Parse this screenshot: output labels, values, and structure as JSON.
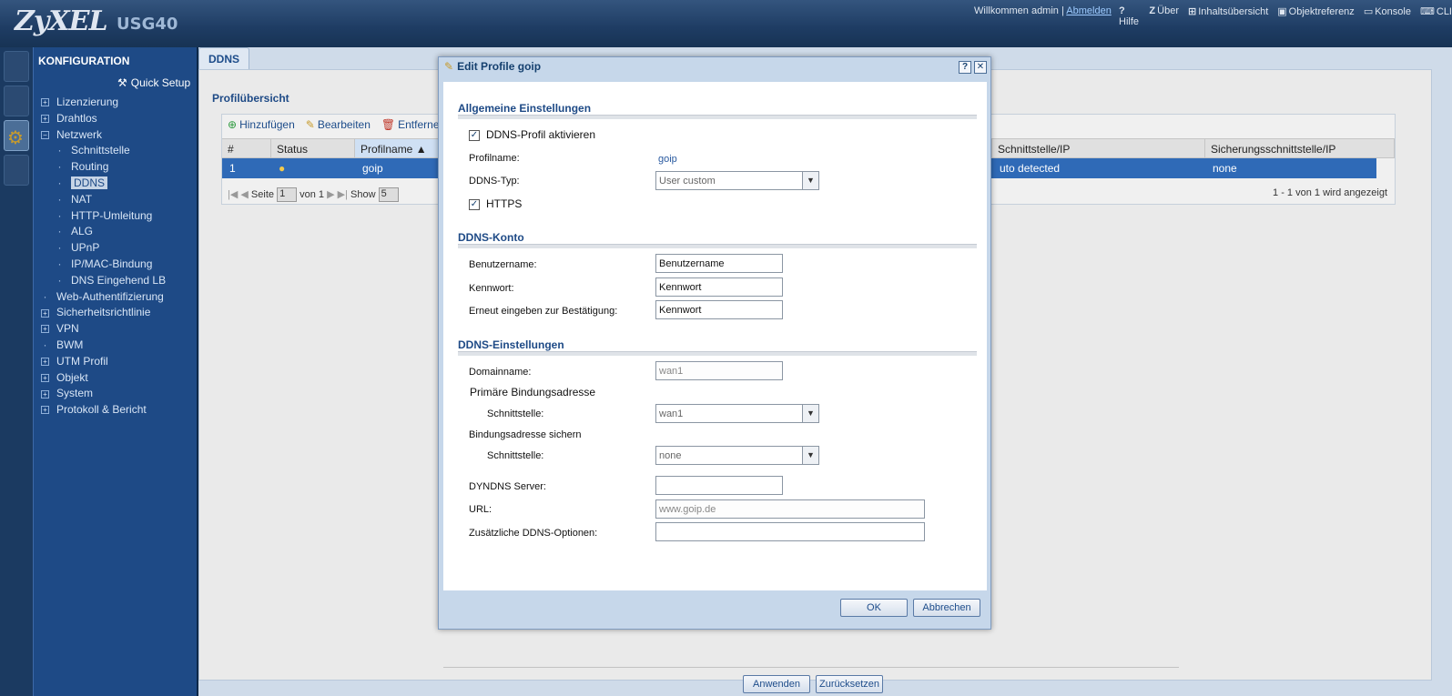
{
  "header": {
    "brand": "ZyXEL",
    "model": "USG40",
    "welcome_prefix": "Willkommen admin |",
    "logout": "Abmelden",
    "links": [
      {
        "icon": "help-icon",
        "glyph": "?",
        "label": "Hilfe"
      },
      {
        "icon": "about-icon",
        "glyph": "Z",
        "label": "Über"
      },
      {
        "icon": "sitemap-icon",
        "glyph": "⊞",
        "label": "Inhaltsübersicht"
      },
      {
        "icon": "object-reference-icon",
        "glyph": "▣",
        "label": "Objektreferenz"
      },
      {
        "icon": "console-icon",
        "glyph": "▭",
        "label": "Konsole"
      },
      {
        "icon": "cli-icon",
        "glyph": "⌨",
        "label": "CLI"
      }
    ]
  },
  "sidebar": {
    "title": "KONFIGURATION",
    "quick_setup": "Quick Setup",
    "items": [
      {
        "label": "Lizenzierung",
        "type": "plus"
      },
      {
        "label": "Drahtlos",
        "type": "plus"
      },
      {
        "label": "Netzwerk",
        "type": "minus"
      },
      {
        "label": "Schnittstelle",
        "type": "sub"
      },
      {
        "label": "Routing",
        "type": "sub"
      },
      {
        "label": "DDNS",
        "type": "sub",
        "selected": true
      },
      {
        "label": "NAT",
        "type": "sub"
      },
      {
        "label": "HTTP-Umleitung",
        "type": "sub"
      },
      {
        "label": "ALG",
        "type": "sub"
      },
      {
        "label": "UPnP",
        "type": "sub"
      },
      {
        "label": "IP/MAC-Bindung",
        "type": "sub"
      },
      {
        "label": "DNS Eingehend LB",
        "type": "sub"
      },
      {
        "label": "Web-Authentifizierung",
        "type": "dot"
      },
      {
        "label": "Sicherheitsrichtlinie",
        "type": "plus"
      },
      {
        "label": "VPN",
        "type": "plus"
      },
      {
        "label": "BWM",
        "type": "dot"
      },
      {
        "label": "UTM Profil",
        "type": "plus"
      },
      {
        "label": "Objekt",
        "type": "plus"
      },
      {
        "label": "System",
        "type": "plus"
      },
      {
        "label": "Protokoll & Bericht",
        "type": "plus"
      }
    ]
  },
  "main": {
    "tab": "DDNS",
    "section_title": "Profilübersicht",
    "toolbar": {
      "add": "Hinzufügen",
      "edit": "Bearbeiten",
      "remove": "Entfernen"
    },
    "columns": [
      "#",
      "Status",
      "Profilname ▲",
      "Schnittstelle/IP",
      "Sicherungsschnittstelle/IP"
    ],
    "row": {
      "num": "1",
      "status_icon": "bulb-icon",
      "name": "goip",
      "iface": "uto detected",
      "backup": "none"
    },
    "pager": {
      "page_label": "Seite",
      "page_value": "1",
      "of": "von 1",
      "show": "Show",
      "show_value": "5",
      "summary": "1 - 1 von 1 wird angezeigt"
    },
    "apply": "Anwenden",
    "reset": "Zurücksetzen"
  },
  "dialog": {
    "title": "Edit Profile goip",
    "help": "?",
    "close": "✕",
    "section_general": "Allgemeine Einstellungen",
    "enable_label": "DDNS-Profil aktivieren",
    "enable_checked": true,
    "profile_name_label": "Profilname:",
    "profile_name_value": "goip",
    "ddns_type_label": "DDNS-Typ:",
    "ddns_type_value": "User custom",
    "https_label": "HTTPS",
    "https_checked": true,
    "section_account": "DDNS-Konto",
    "username_label": "Benutzername:",
    "username_value": "Benutzername",
    "password_label": "Kennwort:",
    "password_value": "Kennwort",
    "confirm_label": "Erneut eingeben zur Bestätigung:",
    "confirm_value": "Kennwort",
    "section_settings": "DDNS-Einstellungen",
    "domain_label": "Domainname:",
    "domain_value": "wan1",
    "primary_binding": "Primäre Bindungsadresse",
    "iface_label": "Schnittstelle:",
    "primary_iface_value": "wan1",
    "backup_binding": "Bindungsadresse sichern",
    "backup_iface_value": "none",
    "server_label": "DYNDNS Server:",
    "server_value": "",
    "url_label": "URL:",
    "url_value": "www.goip.de",
    "options_label": "Zusätzliche DDNS-Optionen:",
    "options_value": "",
    "ok": "OK",
    "cancel": "Abbrechen"
  }
}
